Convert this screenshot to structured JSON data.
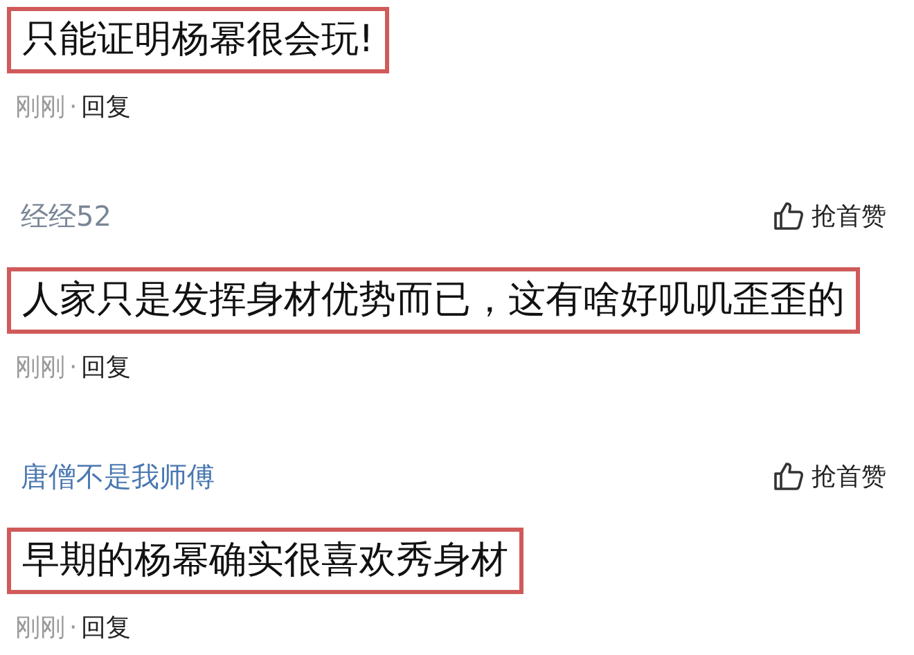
{
  "comments": [
    {
      "text": "只能证明杨幂很会玩!",
      "highlighted": true,
      "time": "刚刚",
      "separator": "·",
      "reply": "回复"
    },
    {
      "user": "经经52",
      "color": "#7a8696",
      "like_label": "抢首赞",
      "text": "人家只是发挥身材优势而已，这有啥好叽叽歪歪的",
      "highlighted": true,
      "time": "刚刚",
      "separator": "·",
      "reply": "回复"
    },
    {
      "user": "唐僧不是我师傅",
      "color": "#4a78b0",
      "like_label": "抢首赞",
      "text": "早期的杨幂确实很喜欢秀身材",
      "highlighted": true,
      "time": "刚刚",
      "separator": "·",
      "reply": "回复"
    }
  ]
}
